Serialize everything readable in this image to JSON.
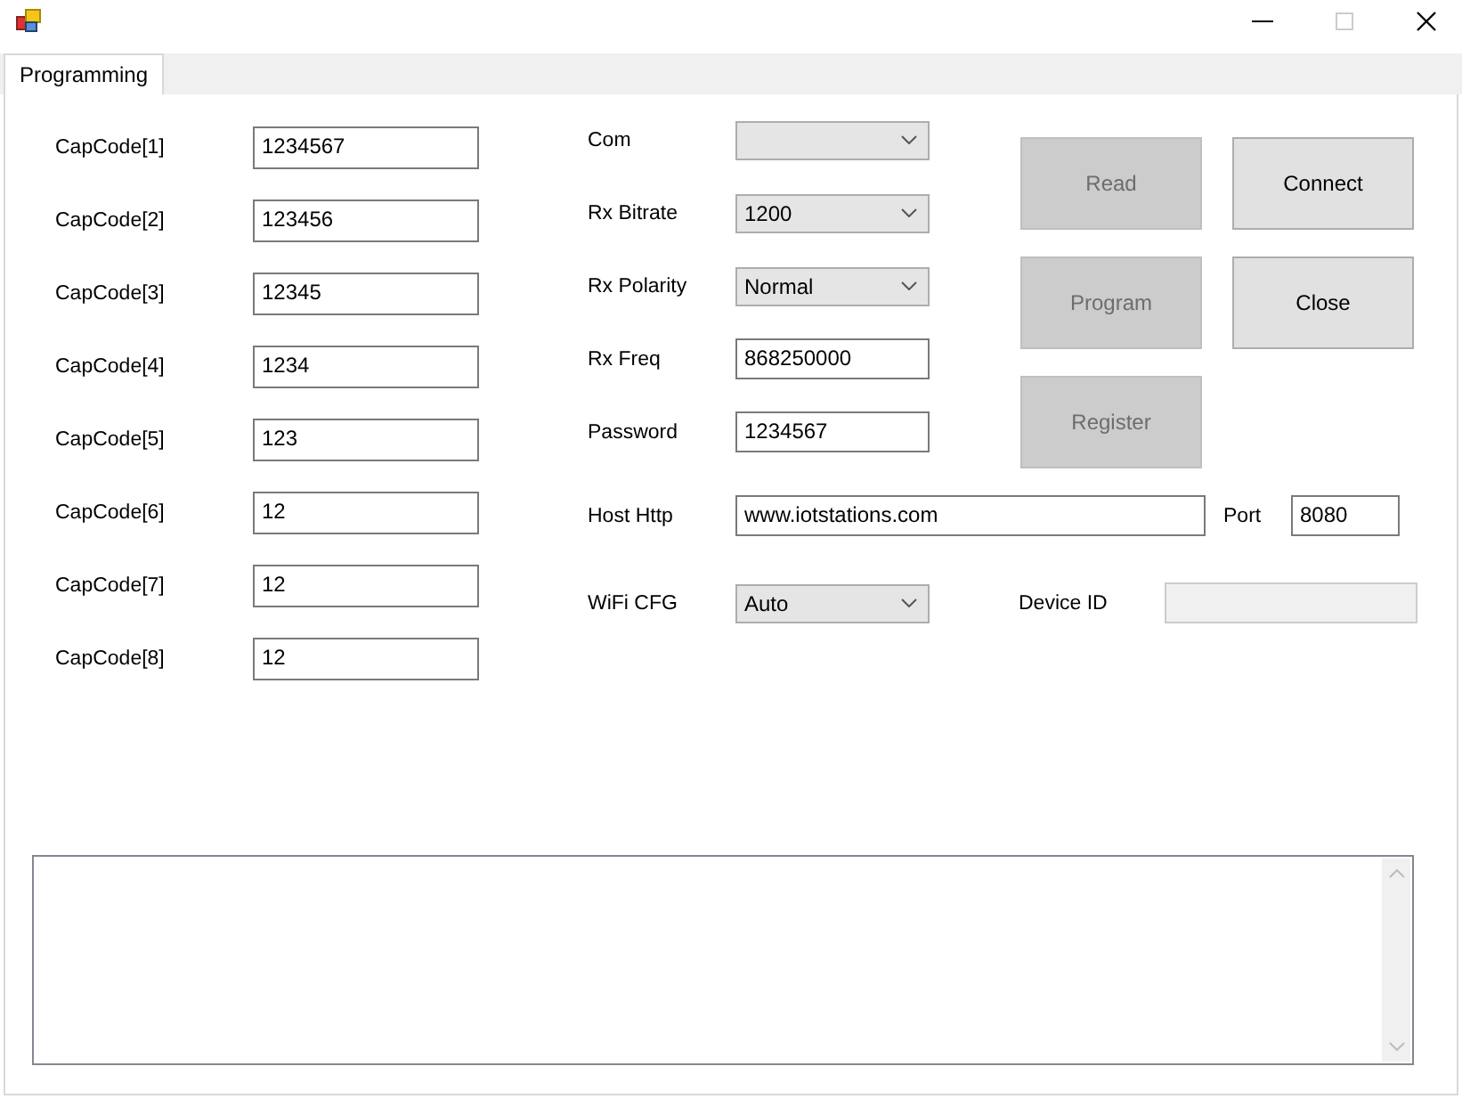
{
  "window": {
    "maximize_disabled": true
  },
  "tabs": [
    {
      "label": "Programming",
      "selected": true
    }
  ],
  "capcodes": [
    {
      "label": "CapCode[1]",
      "value": "1234567"
    },
    {
      "label": "CapCode[2]",
      "value": "123456"
    },
    {
      "label": "CapCode[3]",
      "value": "12345"
    },
    {
      "label": "CapCode[4]",
      "value": "1234"
    },
    {
      "label": "CapCode[5]",
      "value": "123"
    },
    {
      "label": "CapCode[6]",
      "value": "12"
    },
    {
      "label": "CapCode[7]",
      "value": "12"
    },
    {
      "label": "CapCode[8]",
      "value": "12"
    }
  ],
  "fields": [
    {
      "label": "Com",
      "kind": "dropdown"
    },
    {
      "label": "Rx Bitrate",
      "kind": "dropdown",
      "value": "1200"
    },
    {
      "label": "Rx Polarity",
      "kind": "dropdown",
      "value": "Normal"
    },
    {
      "label": "Rx Freq",
      "kind": "text",
      "value": "868250000"
    },
    {
      "label": "Password",
      "kind": "text",
      "value": "1234567"
    }
  ],
  "buttons": [
    {
      "label": "Read",
      "disabled": true
    },
    {
      "label": "Connect",
      "disabled": false
    },
    {
      "label": "Program",
      "disabled": true
    },
    {
      "label": "Close",
      "disabled": false
    },
    {
      "label": "Register",
      "disabled": true
    }
  ],
  "host": {
    "label": "Host Http",
    "value": "www.iotstations.com"
  },
  "port": {
    "label": "Port",
    "value": "8080"
  },
  "wifi": {
    "label": "WiFi CFG",
    "value": "Auto"
  },
  "device_id": {
    "label": "Device ID",
    "disabled": true
  }
}
